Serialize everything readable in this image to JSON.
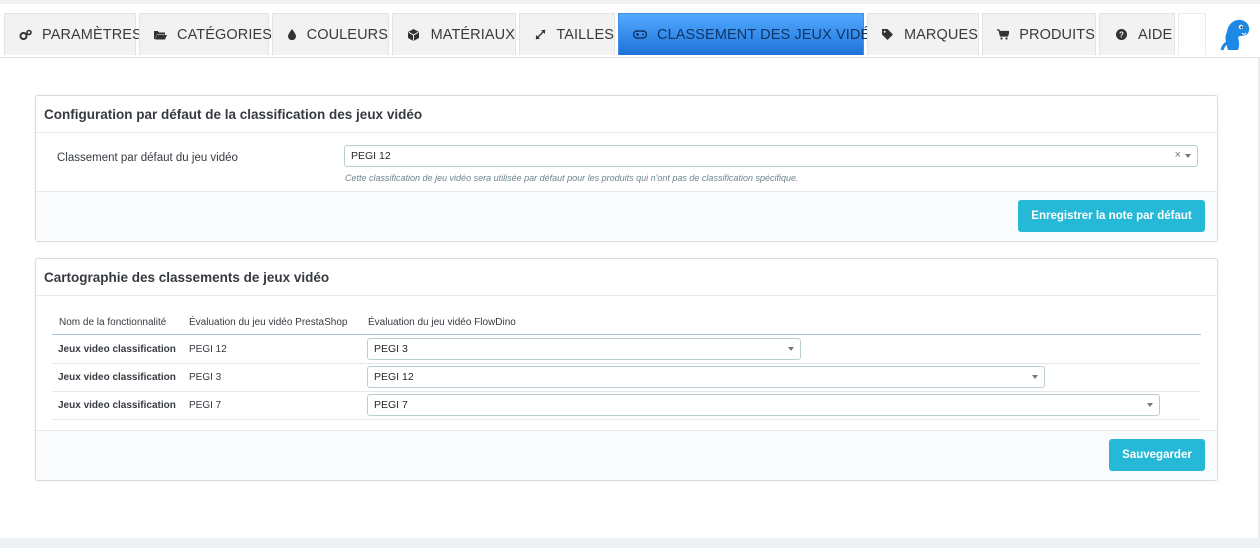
{
  "tabs": [
    {
      "label": "PARAMÈTRES",
      "icon": "cogs-icon",
      "name": "tab-parametres"
    },
    {
      "label": "CATÉGORIES",
      "icon": "folder-open-icon",
      "name": "tab-categories"
    },
    {
      "label": "COULEURS",
      "icon": "tint-icon",
      "name": "tab-couleurs"
    },
    {
      "label": "MATÉRIAUX",
      "icon": "cube-icon",
      "name": "tab-materiaux"
    },
    {
      "label": "TAILLES",
      "icon": "expand-icon",
      "name": "tab-tailles"
    },
    {
      "label": "CLASSEMENT DES JEUX VIDÉO",
      "icon": "gamepad-icon",
      "name": "tab-classement-jeux-video",
      "active": true
    },
    {
      "label": "MARQUES",
      "icon": "tag-icon",
      "name": "tab-marques"
    },
    {
      "label": "PRODUITS",
      "icon": "cart-icon",
      "name": "tab-produits"
    },
    {
      "label": "AIDE",
      "icon": "question-circle-icon",
      "name": "tab-aide"
    }
  ],
  "logo_icon": "flowdino-logo-icon",
  "default_panel": {
    "title": "Configuration par défaut de la classification des jeux vidéo",
    "field_label": "Classement par défaut du jeu vidéo",
    "selected_value": "PEGI 12",
    "help_text": "Cette classification de jeu vidéo sera utilisée par défaut pour les produits qui n'ont pas de classification spécifique.",
    "save_label": "Enregistrer la note par défaut"
  },
  "mapping_panel": {
    "title": "Cartographie des classements de jeux vidéo",
    "columns": [
      "Nom de la fonctionnalité",
      "Évaluation du jeu vidéo PrestaShop",
      "Évaluation du jeu vidéo FlowDino"
    ],
    "rows": [
      {
        "feature": "Jeux video classification",
        "prestashop": "PEGI 12",
        "flowdino": "PEGI 3"
      },
      {
        "feature": "Jeux video classification",
        "prestashop": "PEGI 3",
        "flowdino": "PEGI 12"
      },
      {
        "feature": "Jeux video classification",
        "prestashop": "PEGI 7",
        "flowdino": "PEGI 7"
      }
    ],
    "save_label": "Sauvegarder"
  },
  "colors": {
    "active_tab": "#1d72d8",
    "button": "#25b9d7",
    "logo": "#1e88e5"
  }
}
